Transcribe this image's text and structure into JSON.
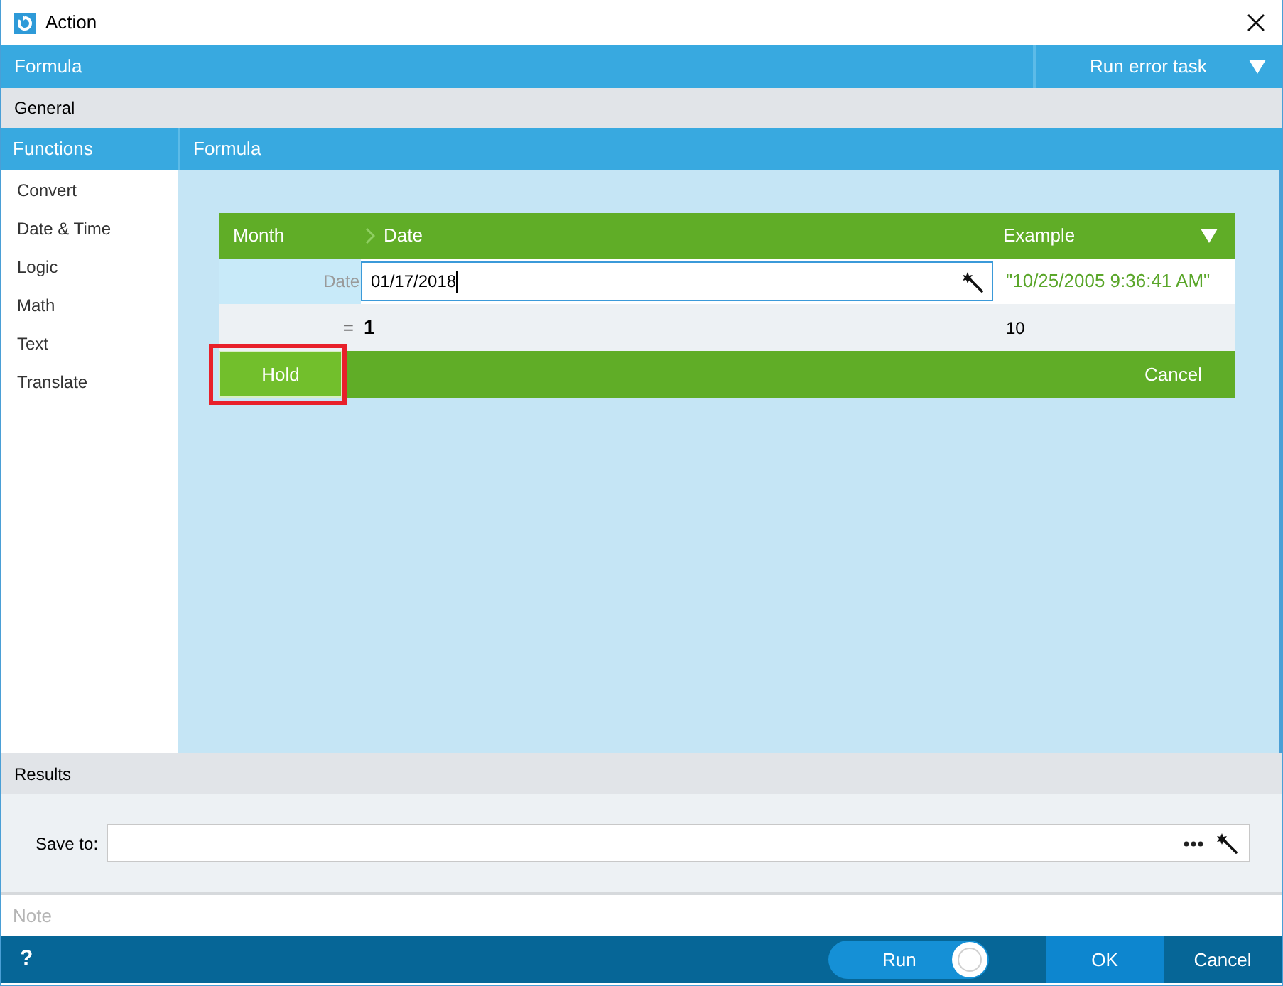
{
  "window": {
    "title": "Action"
  },
  "header": {
    "title": "Formula",
    "error_action": "Run error task"
  },
  "section": {
    "title": "General"
  },
  "functions": {
    "title": "Functions",
    "items": [
      {
        "label": "Convert",
        "selected": false
      },
      {
        "label": "Date & Time",
        "selected": false
      },
      {
        "label": "Logic",
        "selected": false
      },
      {
        "label": "Math",
        "selected": false
      },
      {
        "label": "Text",
        "selected": false
      },
      {
        "label": "Translate",
        "selected": false
      }
    ]
  },
  "formula": {
    "title": "Formula",
    "columns": {
      "function": "Month",
      "argument": "Date",
      "example": "Example"
    },
    "argument": {
      "label": "Date",
      "value": "01/17/2018",
      "example": "\"10/25/2005 9:36:41 AM\""
    },
    "result": {
      "sign": "=",
      "value": "1",
      "example": "10"
    },
    "hold_button": {
      "label": "Hold",
      "highlighted": true
    },
    "cancel_button": {
      "label": "Cancel"
    }
  },
  "results": {
    "title": "Results",
    "save_to": {
      "label": "Save to:"
    }
  },
  "note": {
    "placeholder": "Note"
  },
  "footer": {
    "help": "?",
    "run_toggle": {
      "label": "Run",
      "on": true
    },
    "buttons": [
      {
        "label": "OK",
        "kind": "primary"
      },
      {
        "label": "Cancel",
        "kind": "secondary"
      }
    ]
  }
}
